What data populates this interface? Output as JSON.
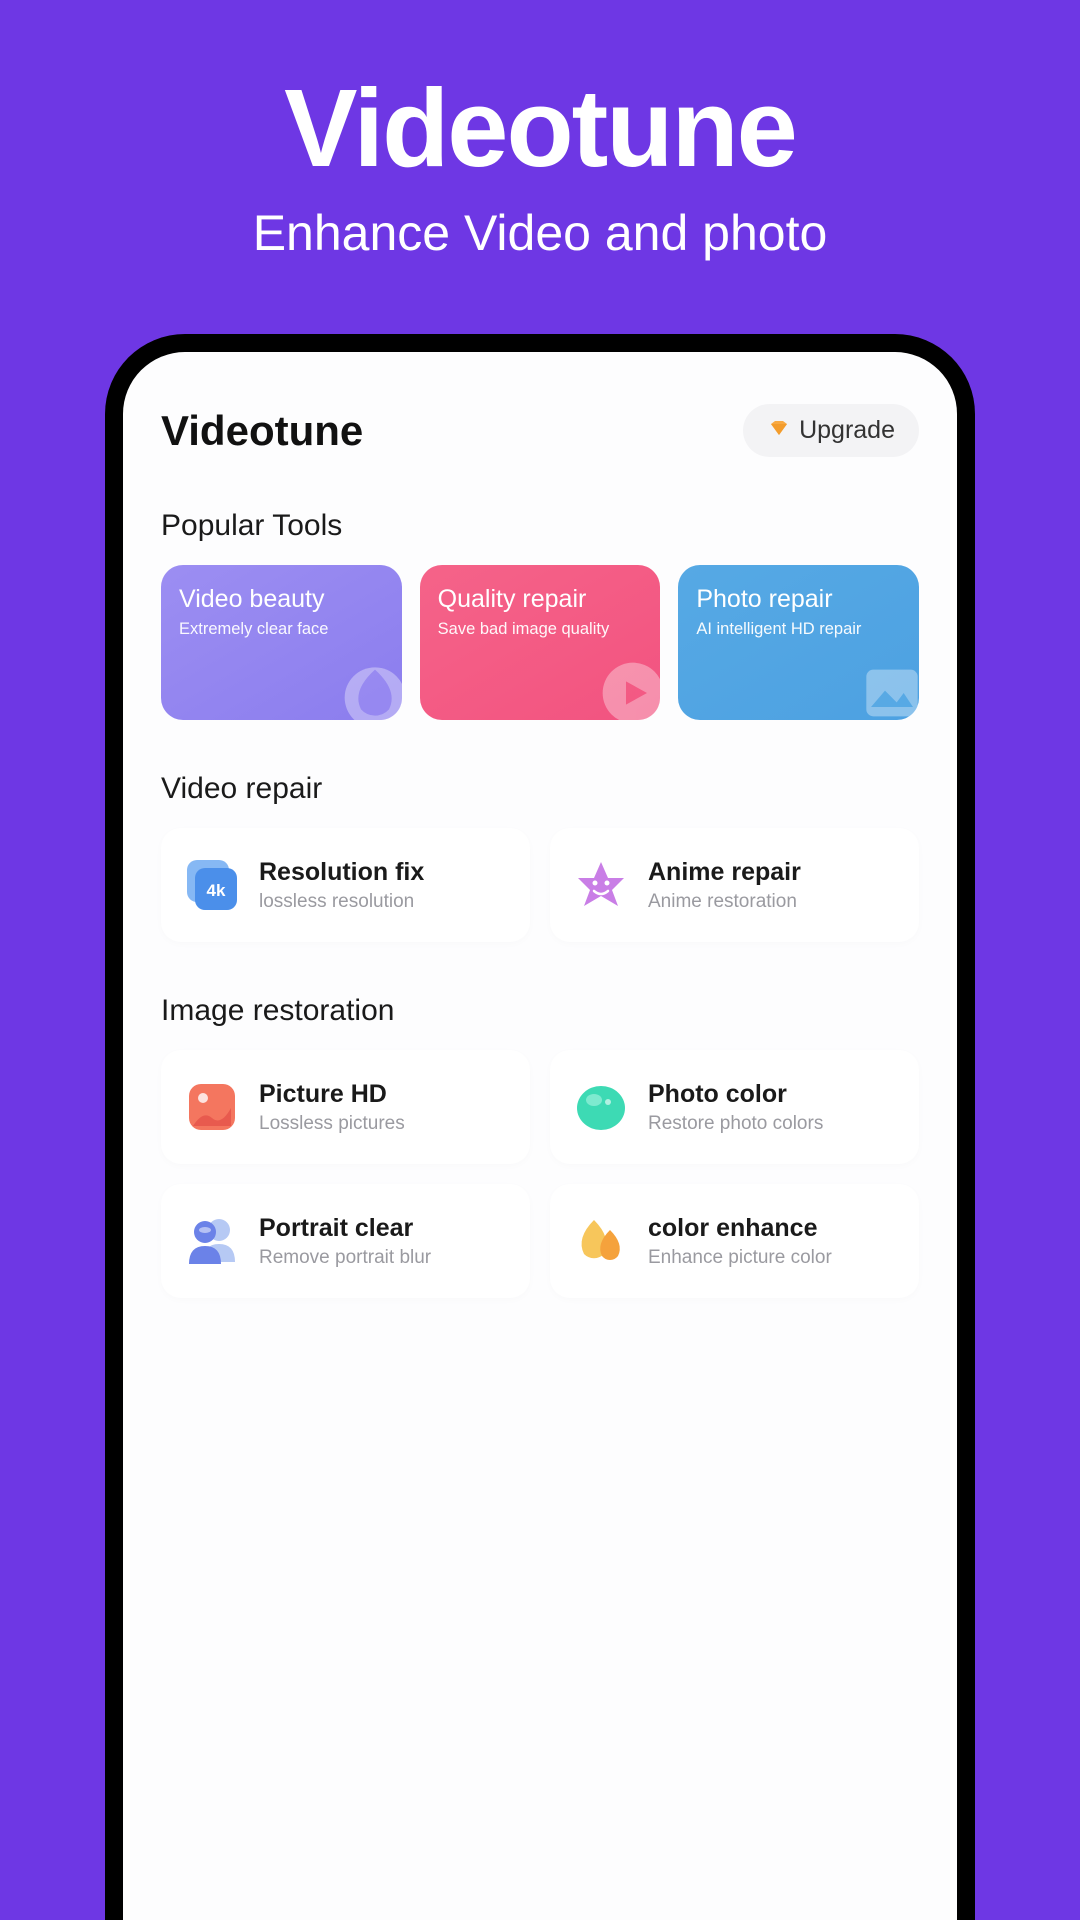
{
  "marketing": {
    "title": "Videotune",
    "subtitle": "Enhance Video and photo"
  },
  "app": {
    "title": "Videotune",
    "upgrade_label": "Upgrade"
  },
  "sections": {
    "popular_heading": "Popular Tools",
    "video_repair_heading": "Video repair",
    "image_restoration_heading": "Image restoration"
  },
  "popular": [
    {
      "title": "Video beauty",
      "subtitle": "Extremely clear face",
      "icon": "drop-icon"
    },
    {
      "title": "Quality repair",
      "subtitle": "Save bad image quality",
      "icon": "play-icon"
    },
    {
      "title": "Photo repair",
      "subtitle": "AI intelligent HD repair",
      "icon": "image-icon"
    }
  ],
  "video_repair": [
    {
      "title": "Resolution fix",
      "subtitle": "lossless resolution",
      "icon": "4k-icon"
    },
    {
      "title": "Anime repair",
      "subtitle": "Anime restoration",
      "icon": "star-icon"
    }
  ],
  "image_restoration": [
    {
      "title": "Picture HD",
      "subtitle": "Lossless pictures",
      "icon": "picture-icon"
    },
    {
      "title": "Photo color",
      "subtitle": "Restore photo colors",
      "icon": "blob-icon"
    },
    {
      "title": "Portrait  clear",
      "subtitle": "Remove portrait blur",
      "icon": "person-icon"
    },
    {
      "title": "color enhance",
      "subtitle": "Enhance picture color",
      "icon": "drops-icon"
    }
  ]
}
